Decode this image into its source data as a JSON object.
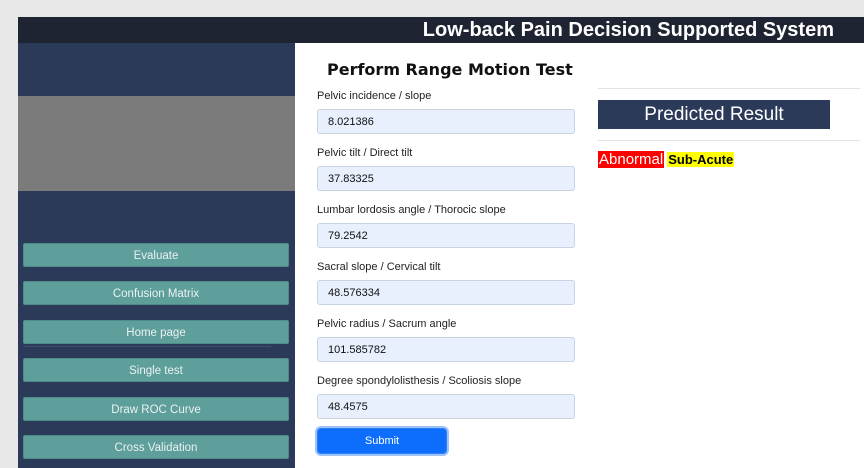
{
  "app": {
    "title": "Low-back Pain Decision Supported System"
  },
  "sidebar": {
    "items": [
      {
        "label": "Evaluate"
      },
      {
        "label": "Confusion Matrix"
      },
      {
        "label": "Home page"
      },
      {
        "label": "Single test"
      },
      {
        "label": "Draw ROC Curve"
      },
      {
        "label": "Cross Validation"
      }
    ]
  },
  "form": {
    "title": "Perform Range Motion Test",
    "fields": [
      {
        "label": "Pelvic incidence / slope",
        "value": "8.021386"
      },
      {
        "label": "Pelvic tilt / Direct tilt",
        "value": "37.83325"
      },
      {
        "label": "Lumbar lordosis angle / Thorocic slope",
        "value": "79.2542"
      },
      {
        "label": "Sacral slope / Cervical tilt",
        "value": "48.576334"
      },
      {
        "label": "Pelvic radius / Sacrum angle",
        "value": "101.585782"
      },
      {
        "label": "Degree spondylolisthesis / Scoliosis slope",
        "value": "48.4575"
      }
    ],
    "submit_label": "Submit"
  },
  "result": {
    "heading": "Predicted Result",
    "status": "Abnormal",
    "stage": "Sub-Acute"
  },
  "colors": {
    "header_bg": "#1f2433",
    "navy": "#2c3a5a",
    "teal_button": "#5e9e9b",
    "submit_blue": "#0d6efd",
    "abnormal_red": "#ff0000",
    "highlight_yellow": "#ffff00"
  }
}
